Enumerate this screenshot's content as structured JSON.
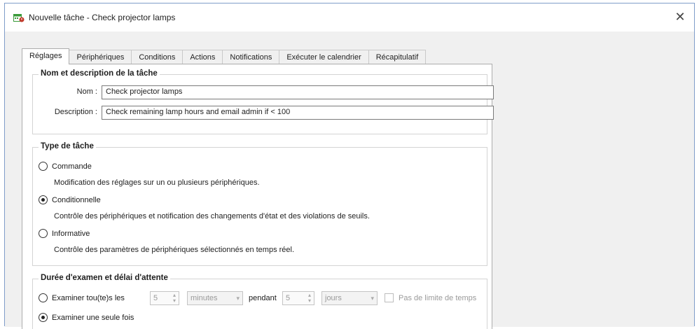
{
  "window": {
    "title": "Nouvelle tâche - Check projector lamps",
    "close_glyph": "✕"
  },
  "tabs": [
    {
      "label": "Réglages",
      "active": true
    },
    {
      "label": "Périphériques"
    },
    {
      "label": "Conditions"
    },
    {
      "label": "Actions"
    },
    {
      "label": "Notifications"
    },
    {
      "label": "Exécuter le calendrier"
    },
    {
      "label": "Récapitulatif"
    }
  ],
  "name_group": {
    "title": "Nom et description de la tâche",
    "name_label": "Nom :",
    "name_value": "Check projector lamps",
    "description_label": "Description :",
    "description_value": "Check remaining lamp hours and email admin if < 100"
  },
  "type_group": {
    "title": "Type de tâche",
    "options": [
      {
        "label": "Commande",
        "checked": false,
        "description": "Modification des réglages sur un ou plusieurs périphériques."
      },
      {
        "label": "Conditionnelle",
        "checked": true,
        "description": "Contrôle des périphériques et notification des changements d'état et des violations de seuils."
      },
      {
        "label": "Informative",
        "checked": false,
        "description": "Contrôle des paramètres de périphériques sélectionnés en temps réel."
      }
    ]
  },
  "duration_group": {
    "title": "Durée d'examen et délai d'attente",
    "examine_every_label": "Examiner tou(te)s les",
    "interval_value": "5",
    "interval_unit": "minutes",
    "during_label": "pendant",
    "duration_value": "5",
    "duration_unit": "jours",
    "no_limit_label": "Pas de limite de temps",
    "examine_once_label": "Examiner une seule fois",
    "selected": "once"
  },
  "colors": {
    "window_border": "#7f9dc9",
    "client_bg": "#f0f0f0",
    "app_icon_green": "#3a9a3a",
    "app_icon_red": "#c0392b"
  }
}
